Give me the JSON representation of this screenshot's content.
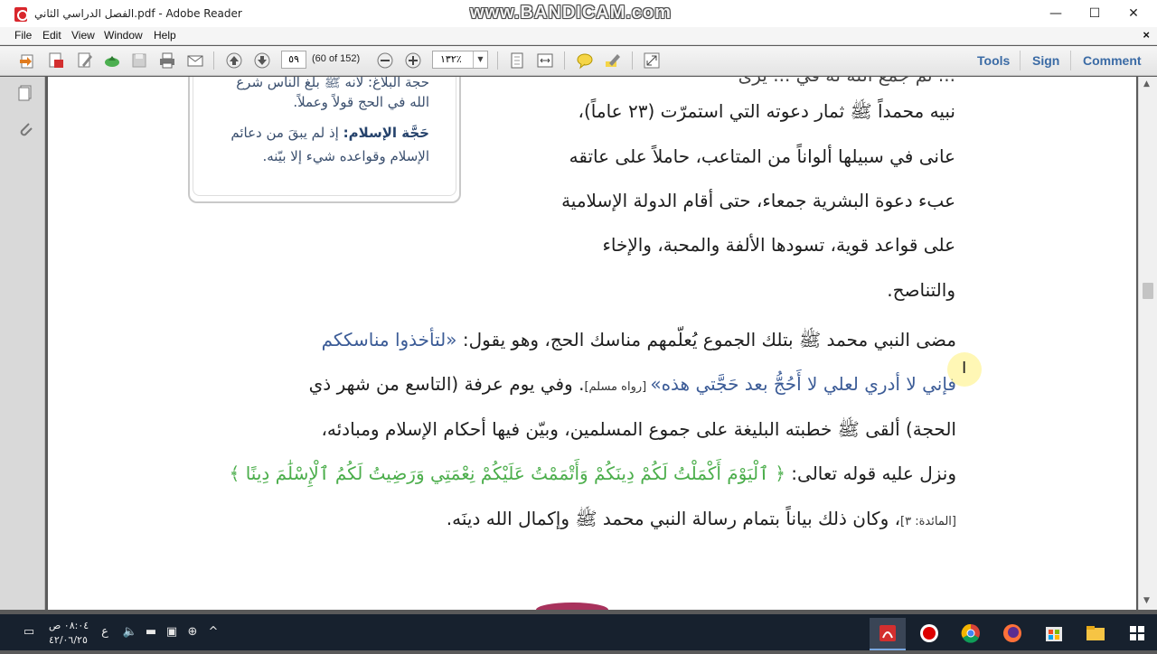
{
  "window": {
    "title": "الفصل الدراسي الثاني.pdf - Adobe Reader",
    "watermark": "www.BANDICAM.com",
    "minimize": "—",
    "maximize": "☐",
    "close": "✕"
  },
  "menu": {
    "items": [
      "File",
      "Edit",
      "View",
      "Window",
      "Help"
    ],
    "doc_close": "×"
  },
  "toolbar": {
    "page_number": "٥٩",
    "page_count": "(60 of 152)",
    "zoom": "١٣٢٪",
    "tools_label": "Tools",
    "sign_label": "Sign",
    "comment_label": "Comment"
  },
  "sidebar_box": {
    "line1": "حجة البلاغ: لأنه ﷺ بلغ الناس شرع",
    "line2": "الله في الحج قولاً وعملاً.",
    "line3_label": "حَجَّة الإسلام:",
    "line3_text": " إذ لم يبقَ من دعائم",
    "line4": "الإسلام وقواعده شيء إلا بيّنه."
  },
  "paragraph1": {
    "line0": "... ثم جمع الله له في ... يرى",
    "line1": "نبيه محمداً ﷺ ثمار دعوته التي استمرّت (٢٣ عاماً)،",
    "line2": "عانى في سبيلها ألواناً من المتاعب، حاملاً على عاتقه",
    "line3": "عبء دعوة البشرية جمعاء، حتى أقام الدولة الإسلامية",
    "line4": "على قواعد قوية، تسودها الألفة والمحبة، والإخاء",
    "line5": "والتناصح."
  },
  "paragraph2": {
    "l1_plain": "مضى النبي محمد ﷺ بتلك الجموع يُعلّمهم مناسك الحج، وهو يقول: ",
    "l1_quote": "«لتأخذوا مناسككم",
    "l2_quote": "فإني لا أدري لعلي لا أَحُجُّ بعد حَجَّتي هذه»",
    "l2_ref": " [رواه مسلم]",
    "l2_plain": ". وفي يوم عرفة (التاسع من شهر ذي",
    "l3": "الحجة) ألقى ﷺ خطبته البليغة على جموع المسلمين، وبيّن فيها أحكام الإسلام ومبادئه،",
    "l4_plain": "ونزل عليه قوله تعالى: ",
    "l4_verse": "﴿ ٱلْيَوْمَ أَكْمَلْتُ لَكُمْ دِينَكُمْ وَأَتْمَمْتُ عَلَيْكُمْ نِعْمَتِي وَرَضِيتُ لَكُمُ ٱلْإِسْلَٰمَ دِينًا ﴾",
    "l5_ref": "[المائدة: ٣]",
    "l5_plain": "، وكان ذلك بياناً بتمام رسالة النبي محمد ﷺ وإكمال الله دينَه."
  },
  "taskbar": {
    "time": "٠٨:٠٤ ص",
    "date": "٤٢/٠٦/٢٥",
    "lang": "ع",
    "icons": [
      "adobe-reader",
      "bandicam",
      "chrome",
      "firefox",
      "store",
      "file-explorer",
      "start"
    ]
  },
  "colors": {
    "accent_link": "#3b6ba5",
    "quote_blue": "#3c5c97",
    "verse_green": "#4cae4c",
    "taskbar": "#17212e"
  }
}
